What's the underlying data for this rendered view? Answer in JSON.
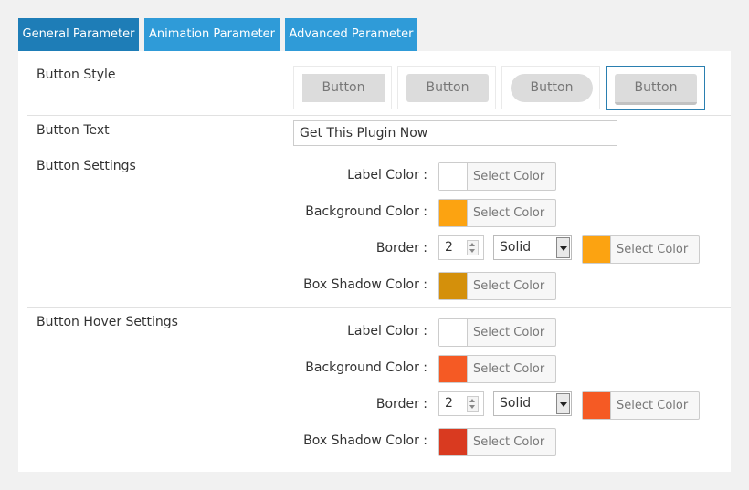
{
  "tabs": [
    {
      "label": "General Parameter",
      "active": true
    },
    {
      "label": "Animation Parameter",
      "active": false
    },
    {
      "label": "Advanced Parameter",
      "active": false
    }
  ],
  "button_style": {
    "label": "Button Style",
    "options": [
      "Button",
      "Button",
      "Button",
      "Button"
    ],
    "selected_index": 3
  },
  "button_text": {
    "label": "Button Text",
    "value": "Get This Plugin Now"
  },
  "button_settings": {
    "title": "Button Settings",
    "label_color": {
      "label": "Label Color :",
      "picker": "Select Color",
      "color": "#ffffff"
    },
    "background_color": {
      "label": "Background Color :",
      "picker": "Select Color",
      "color": "#fca311"
    },
    "border": {
      "label": "Border :",
      "width": "2",
      "style": "Solid",
      "picker": "Select Color",
      "color": "#fca311"
    },
    "box_shadow_color": {
      "label": "Box Shadow Color :",
      "picker": "Select Color",
      "color": "#d4900b"
    }
  },
  "hover_settings": {
    "title": "Button Hover Settings",
    "label_color": {
      "label": "Label Color :",
      "picker": "Select Color",
      "color": "#ffffff"
    },
    "background_color": {
      "label": "Background Color :",
      "picker": "Select Color",
      "color": "#f55a24"
    },
    "border": {
      "label": "Border :",
      "width": "2",
      "style": "Solid",
      "picker": "Select Color",
      "color": "#f55a24"
    },
    "box_shadow_color": {
      "label": "Box Shadow Color :",
      "picker": "Select Color",
      "color": "#d93a20"
    }
  },
  "colors": {
    "tab_active": "#1e7db7",
    "tab_inactive": "#2f9bd8",
    "selected_border": "#2a7fb0"
  }
}
